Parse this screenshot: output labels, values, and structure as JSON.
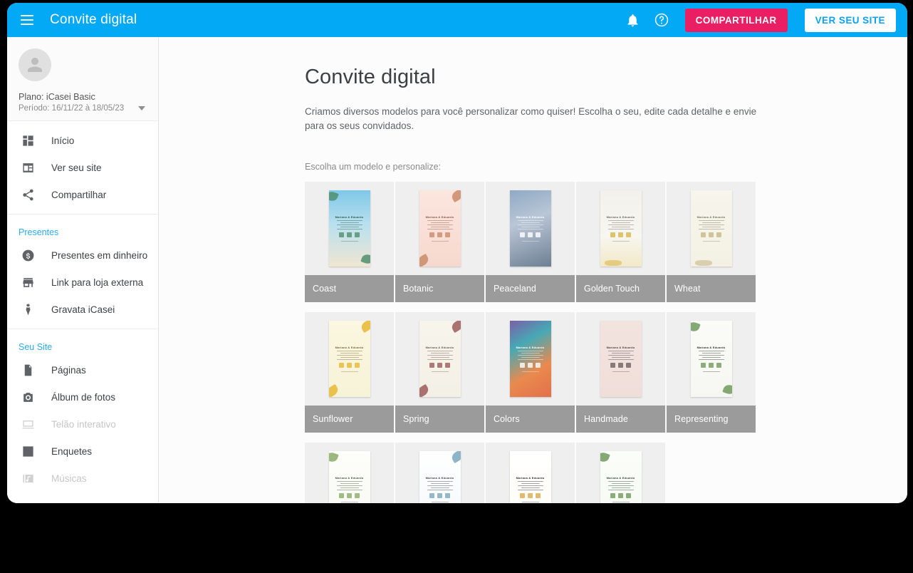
{
  "topbar": {
    "menu_icon": "hamburger-menu-icon",
    "title": "Convite digital",
    "notifications_icon": "bell-icon",
    "help_icon": "help-circle-icon",
    "share_label": "COMPARTILHAR",
    "view_site_label": "VER SEU SITE",
    "bg_color": "#03A9F4",
    "share_color": "#E91E63"
  },
  "sidebar": {
    "avatar_icon": "user-avatar-icon",
    "plan": "Plano: iCasei Basic",
    "period": "Período: 16/11/22 à 18/05/23",
    "caret_icon": "chevron-down-icon",
    "main_items": [
      {
        "label": "Início",
        "icon": "dashboard-icon",
        "disabled": false
      },
      {
        "label": "Ver seu site",
        "icon": "window-icon",
        "disabled": false
      },
      {
        "label": "Compartilhar",
        "icon": "share-icon",
        "disabled": false
      }
    ],
    "groups": [
      {
        "title": "Presentes",
        "accent": "#29aaf2",
        "items": [
          {
            "label": "Presentes em dinheiro",
            "icon": "money-dollar-icon",
            "disabled": false
          },
          {
            "label": "Link para loja externa",
            "icon": "store-icon",
            "disabled": false
          },
          {
            "label": "Gravata iCasei",
            "icon": "necktie-icon",
            "disabled": false
          }
        ]
      },
      {
        "title": "Seu Site",
        "accent": "#29aaf2",
        "items": [
          {
            "label": "Páginas",
            "icon": "document-icon",
            "disabled": false
          },
          {
            "label": "Álbum de fotos",
            "icon": "camera-icon",
            "disabled": false
          },
          {
            "label": "Telão interativo",
            "icon": "screen-icon",
            "disabled": true
          },
          {
            "label": "Enquetes",
            "icon": "bar-chart-icon",
            "disabled": false
          },
          {
            "label": "Músicas",
            "icon": "music-note-icon",
            "disabled": true
          }
        ]
      }
    ]
  },
  "main": {
    "title": "Convite digital",
    "description": "Criamos diversos modelos para você personalizar como quiser! Escolha o seu, edite cada detalhe e envie para os seus convidados.",
    "choose_label": "Escolha um modelo e personalize:",
    "label_bg": "#9b9b9b",
    "card_bg": "#efefef",
    "templates": [
      {
        "name": "Coast",
        "bg": "linear-gradient(180deg,#7ec8e8 0%,#b9e0ef 45%,#f0e6d2 100%)",
        "text": "#2f5d4a",
        "accent": "#4f8f6e",
        "deco": "leaf-green"
      },
      {
        "name": "Botanic",
        "bg": "linear-gradient(180deg,#fbe6de 0%,#f9ded6 60%,#f6d8cd 100%)",
        "text": "#8a5a46",
        "accent": "#c98b6a",
        "deco": "floral-peach"
      },
      {
        "name": "Peaceland",
        "bg": "linear-gradient(160deg,#8fa9c4 0%,#b9c6d6 40%,#6e7f93 100%)",
        "text": "#ffffff",
        "accent": "#ffffff",
        "deco": "photo-blossom"
      },
      {
        "name": "Golden Touch",
        "bg": "linear-gradient(180deg,#f2f1ec 0%,#f7f6f0 60%,#f3e9c8 100%)",
        "text": "#6c6a60",
        "accent": "#d8b84e",
        "deco": "gold-brush"
      },
      {
        "name": "Wheat",
        "bg": "linear-gradient(180deg,#f7f5ec 0%,#f4f1e4 100%)",
        "text": "#7a7460",
        "accent": "#c6b888",
        "deco": "wheat-sprig"
      },
      {
        "name": "Sunflower",
        "bg": "linear-gradient(180deg,#fbf7e0 0%,#f7f3d8 100%)",
        "text": "#7a6a3a",
        "accent": "#e8b733",
        "deco": "sunflower"
      },
      {
        "name": "Spring",
        "bg": "linear-gradient(180deg,#f7f4ec 0%,#f4f0e6 100%)",
        "text": "#6d5a50",
        "accent": "#9c5a5a",
        "deco": "spring-floral"
      },
      {
        "name": "Colors",
        "bg": "linear-gradient(150deg,#7b5fa8 0%,#46a9b5 30%,#e98a4e 65%,#e2704a 100%)",
        "text": "#ffffff",
        "accent": "#ffffff",
        "deco": "gradient-blur"
      },
      {
        "name": "Handmade",
        "bg": "linear-gradient(180deg,#f3e3de 0%,#f0ded9 100%)",
        "text": "#4c4643",
        "accent": "#6b625c",
        "deco": "torn-paper"
      },
      {
        "name": "Representing",
        "bg": "linear-gradient(180deg,#fbfbf8 0%,#f6f7f2 100%)",
        "text": "#2f3a30",
        "accent": "#6f9a5a",
        "deco": "olive-branch"
      },
      {
        "name": "",
        "bg": "linear-gradient(180deg,#fdfdf9 0%,#f8faf4 100%)",
        "text": "#4a5a44",
        "accent": "#8aab6a",
        "deco": "vine-frame"
      },
      {
        "name": "",
        "bg": "linear-gradient(180deg,#ffffff 0%,#f4f8fa 100%)",
        "text": "#3c4a54",
        "accent": "#7aa8bd",
        "deco": "blue-leaf"
      },
      {
        "name": "",
        "bg": "linear-gradient(180deg,#ffffff 0%,#fffdf6 100%)",
        "text": "#2e2e2e",
        "accent": "#d9a94e",
        "deco": "gold-crest"
      },
      {
        "name": "",
        "bg": "linear-gradient(180deg,#fbfdf9 0%,#f5faf2 100%)",
        "text": "#3a4a38",
        "accent": "#6f9a5a",
        "deco": "eucalyptus"
      }
    ]
  }
}
